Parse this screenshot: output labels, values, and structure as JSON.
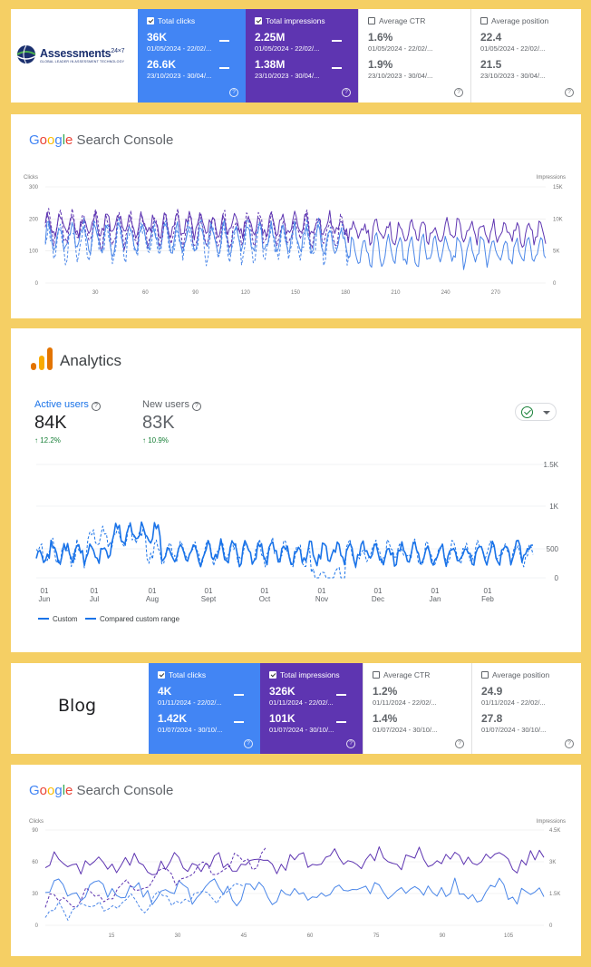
{
  "top_cards": {
    "logo": {
      "name": "Assessments",
      "suffix": "24×7",
      "tagline": "GLOBAL LEADER IN ASSESSMENT TECHNOLOGY"
    },
    "cards": [
      {
        "label": "Total clicks",
        "value1": "36K",
        "date1": "01/05/2024 - 22/02/...",
        "value2": "26.6K",
        "date2": "23/10/2023 - 30/04/..."
      },
      {
        "label": "Total impressions",
        "value1": "2.25M",
        "date1": "01/05/2024 - 22/02/...",
        "value2": "1.38M",
        "date2": "23/10/2023 - 30/04/..."
      },
      {
        "label": "Average CTR",
        "value1": "1.6%",
        "date1": "01/05/2024 - 22/02/...",
        "value2": "1.9%",
        "date2": "23/10/2023 - 30/04/..."
      },
      {
        "label": "Average position",
        "value1": "22.4",
        "date1": "01/05/2024 - 22/02/...",
        "value2": "21.5",
        "date2": "23/10/2023 - 30/04/..."
      }
    ]
  },
  "gsc1": {
    "brand": {
      "g1": "G",
      "g2": "o",
      "g3": "o",
      "g4": "g",
      "g5": "l",
      "g6": "e",
      "rest": " Search Console"
    },
    "left_axis": "Clicks",
    "right_axis": "Impressions",
    "left_ticks": [
      "300",
      "200",
      "100",
      "0"
    ],
    "right_ticks": [
      "15K",
      "10K",
      "5K",
      "0"
    ],
    "x_ticks": [
      "30",
      "60",
      "90",
      "120",
      "150",
      "180",
      "210",
      "240",
      "270"
    ]
  },
  "analytics": {
    "title": "Analytics",
    "metrics": [
      {
        "label": "Active users",
        "value": "84K",
        "change": "12.2%"
      },
      {
        "label": "New users",
        "value": "83K",
        "change": "10.9%"
      }
    ],
    "y_ticks": [
      "1.5K",
      "1K",
      "500",
      "0"
    ],
    "months": [
      {
        "day": "01",
        "name": "Jun"
      },
      {
        "day": "01",
        "name": "Jul"
      },
      {
        "day": "01",
        "name": "Aug"
      },
      {
        "day": "01",
        "name": "Sept"
      },
      {
        "day": "01",
        "name": "Oct"
      },
      {
        "day": "01",
        "name": "Nov"
      },
      {
        "day": "01",
        "name": "Dec"
      },
      {
        "day": "01",
        "name": "Jan"
      },
      {
        "day": "01",
        "name": "Feb"
      }
    ],
    "legend": {
      "custom": "Custom",
      "compared": "Compared custom range"
    }
  },
  "blog_cards": {
    "title": "Blog",
    "cards": [
      {
        "label": "Total clicks",
        "value1": "4K",
        "date1": "01/11/2024 - 22/02/...",
        "value2": "1.42K",
        "date2": "01/07/2024 - 30/10/..."
      },
      {
        "label": "Total impressions",
        "value1": "326K",
        "date1": "01/11/2024 - 22/02/...",
        "value2": "101K",
        "date2": "01/07/2024 - 30/10/..."
      },
      {
        "label": "Average CTR",
        "value1": "1.2%",
        "date1": "01/11/2024 - 22/02/...",
        "value2": "1.4%",
        "date2": "01/07/2024 - 30/10/..."
      },
      {
        "label": "Average position",
        "value1": "24.9",
        "date1": "01/11/2024 - 22/02/...",
        "value2": "27.8",
        "date2": "01/07/2024 - 30/10/..."
      }
    ]
  },
  "gsc2": {
    "left_axis": "Clicks",
    "right_axis": "Impressions",
    "left_ticks": [
      "90",
      "60",
      "30",
      "0"
    ],
    "right_ticks": [
      "4.5K",
      "3K",
      "1.5K",
      "0"
    ],
    "x_ticks": [
      "15",
      "30",
      "45",
      "60",
      "75",
      "90",
      "105"
    ]
  },
  "colors": {
    "clicks": "#4a86e8",
    "impressions": "#5e35b1",
    "analytics_line": "#1a73e8",
    "background": "#f5cf64"
  }
}
